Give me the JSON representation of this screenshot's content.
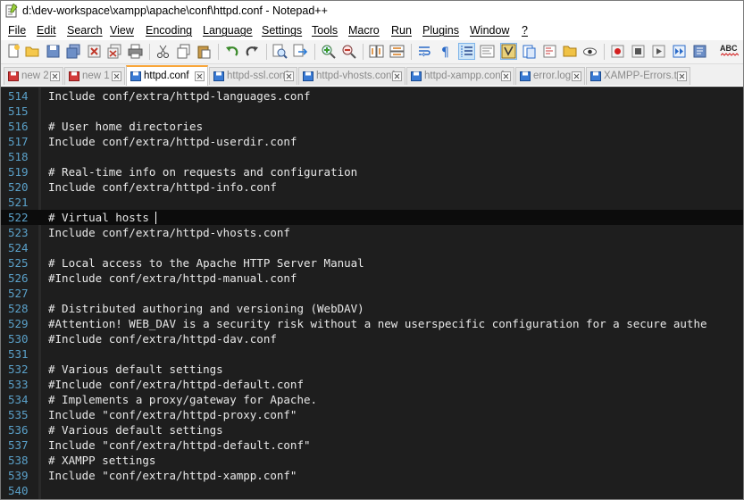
{
  "window": {
    "title": "d:\\dev-workspace\\xampp\\apache\\conf\\httpd.conf - Notepad++"
  },
  "menu": [
    "File",
    "Edit",
    "Search",
    "View",
    "Encoding",
    "Language",
    "Settings",
    "Tools",
    "Macro",
    "Run",
    "Plugins",
    "Window",
    "?"
  ],
  "toolbar": {
    "buttons": [
      "new-file-icon",
      "open-file-icon",
      "save-icon",
      "save-all-icon",
      "close-icon",
      "close-all-icon",
      "print-icon",
      "cut-icon",
      "copy-icon",
      "paste-icon",
      "undo-icon",
      "redo-icon",
      "find-icon",
      "replace-icon",
      "zoom-in-icon",
      "zoom-out-icon",
      "sync-vertical-icon",
      "sync-horizontal-icon",
      "word-wrap-icon",
      "show-all-characters-icon",
      "indent-guide-icon",
      "user-defined-language-icon",
      "document-map-icon",
      "function-list-icon",
      "folder-workspace-icon",
      "monitoring-icon",
      "record-macro-icon",
      "stop-recording-icon",
      "playback-macro-icon",
      "run-macro-multiple-icon",
      "save-macro-icon",
      "spell-check-icon"
    ],
    "spellcheck_label": "ABC"
  },
  "tabs": [
    {
      "label": "new 2",
      "saved": false,
      "active": false
    },
    {
      "label": "new 1",
      "saved": false,
      "active": false
    },
    {
      "label": "httpd.conf",
      "saved": true,
      "active": true
    },
    {
      "label": "httpd-ssl.conf",
      "saved": true,
      "active": false
    },
    {
      "label": "httpd-vhosts.conf",
      "saved": true,
      "active": false
    },
    {
      "label": "httpd-xampp.conf",
      "saved": true,
      "active": false
    },
    {
      "label": "error.log",
      "saved": true,
      "active": false
    },
    {
      "label": "XAMPP-Errors.txt",
      "saved": true,
      "active": false
    }
  ],
  "editor": {
    "current_line": "522",
    "lines": [
      {
        "n": "514",
        "text": "Include conf/extra/httpd-languages.conf"
      },
      {
        "n": "515",
        "text": ""
      },
      {
        "n": "516",
        "text": "# User home directories"
      },
      {
        "n": "517",
        "text": "Include conf/extra/httpd-userdir.conf"
      },
      {
        "n": "518",
        "text": ""
      },
      {
        "n": "519",
        "text": "# Real-time info on requests and configuration"
      },
      {
        "n": "520",
        "text": "Include conf/extra/httpd-info.conf"
      },
      {
        "n": "521",
        "text": ""
      },
      {
        "n": "522",
        "text": "# Virtual hosts"
      },
      {
        "n": "523",
        "text": "Include conf/extra/httpd-vhosts.conf"
      },
      {
        "n": "524",
        "text": ""
      },
      {
        "n": "525",
        "text": "# Local access to the Apache HTTP Server Manual"
      },
      {
        "n": "526",
        "text": "#Include conf/extra/httpd-manual.conf"
      },
      {
        "n": "527",
        "text": ""
      },
      {
        "n": "528",
        "text": "# Distributed authoring and versioning (WebDAV)"
      },
      {
        "n": "529",
        "text": "#Attention! WEB_DAV is a security risk without a new userspecific configuration for a secure authe"
      },
      {
        "n": "530",
        "text": "#Include conf/extra/httpd-dav.conf"
      },
      {
        "n": "531",
        "text": ""
      },
      {
        "n": "532",
        "text": "# Various default settings"
      },
      {
        "n": "533",
        "text": "#Include conf/extra/httpd-default.conf"
      },
      {
        "n": "534",
        "text": "# Implements a proxy/gateway for Apache."
      },
      {
        "n": "535",
        "text": "Include \"conf/extra/httpd-proxy.conf\""
      },
      {
        "n": "536",
        "text": "# Various default settings"
      },
      {
        "n": "537",
        "text": "Include \"conf/extra/httpd-default.conf\""
      },
      {
        "n": "538",
        "text": "# XAMPP settings"
      },
      {
        "n": "539",
        "text": "Include \"conf/extra/httpd-xampp.conf\""
      },
      {
        "n": "540",
        "text": ""
      }
    ]
  },
  "colors": {
    "editor_bg": "#1e1e1e",
    "line_number": "#5aa0c8",
    "active_tab_accent": "#f9a63a",
    "saved_tab_icon": "#3a7bd5",
    "unsaved_tab_icon": "#d33a3a"
  }
}
